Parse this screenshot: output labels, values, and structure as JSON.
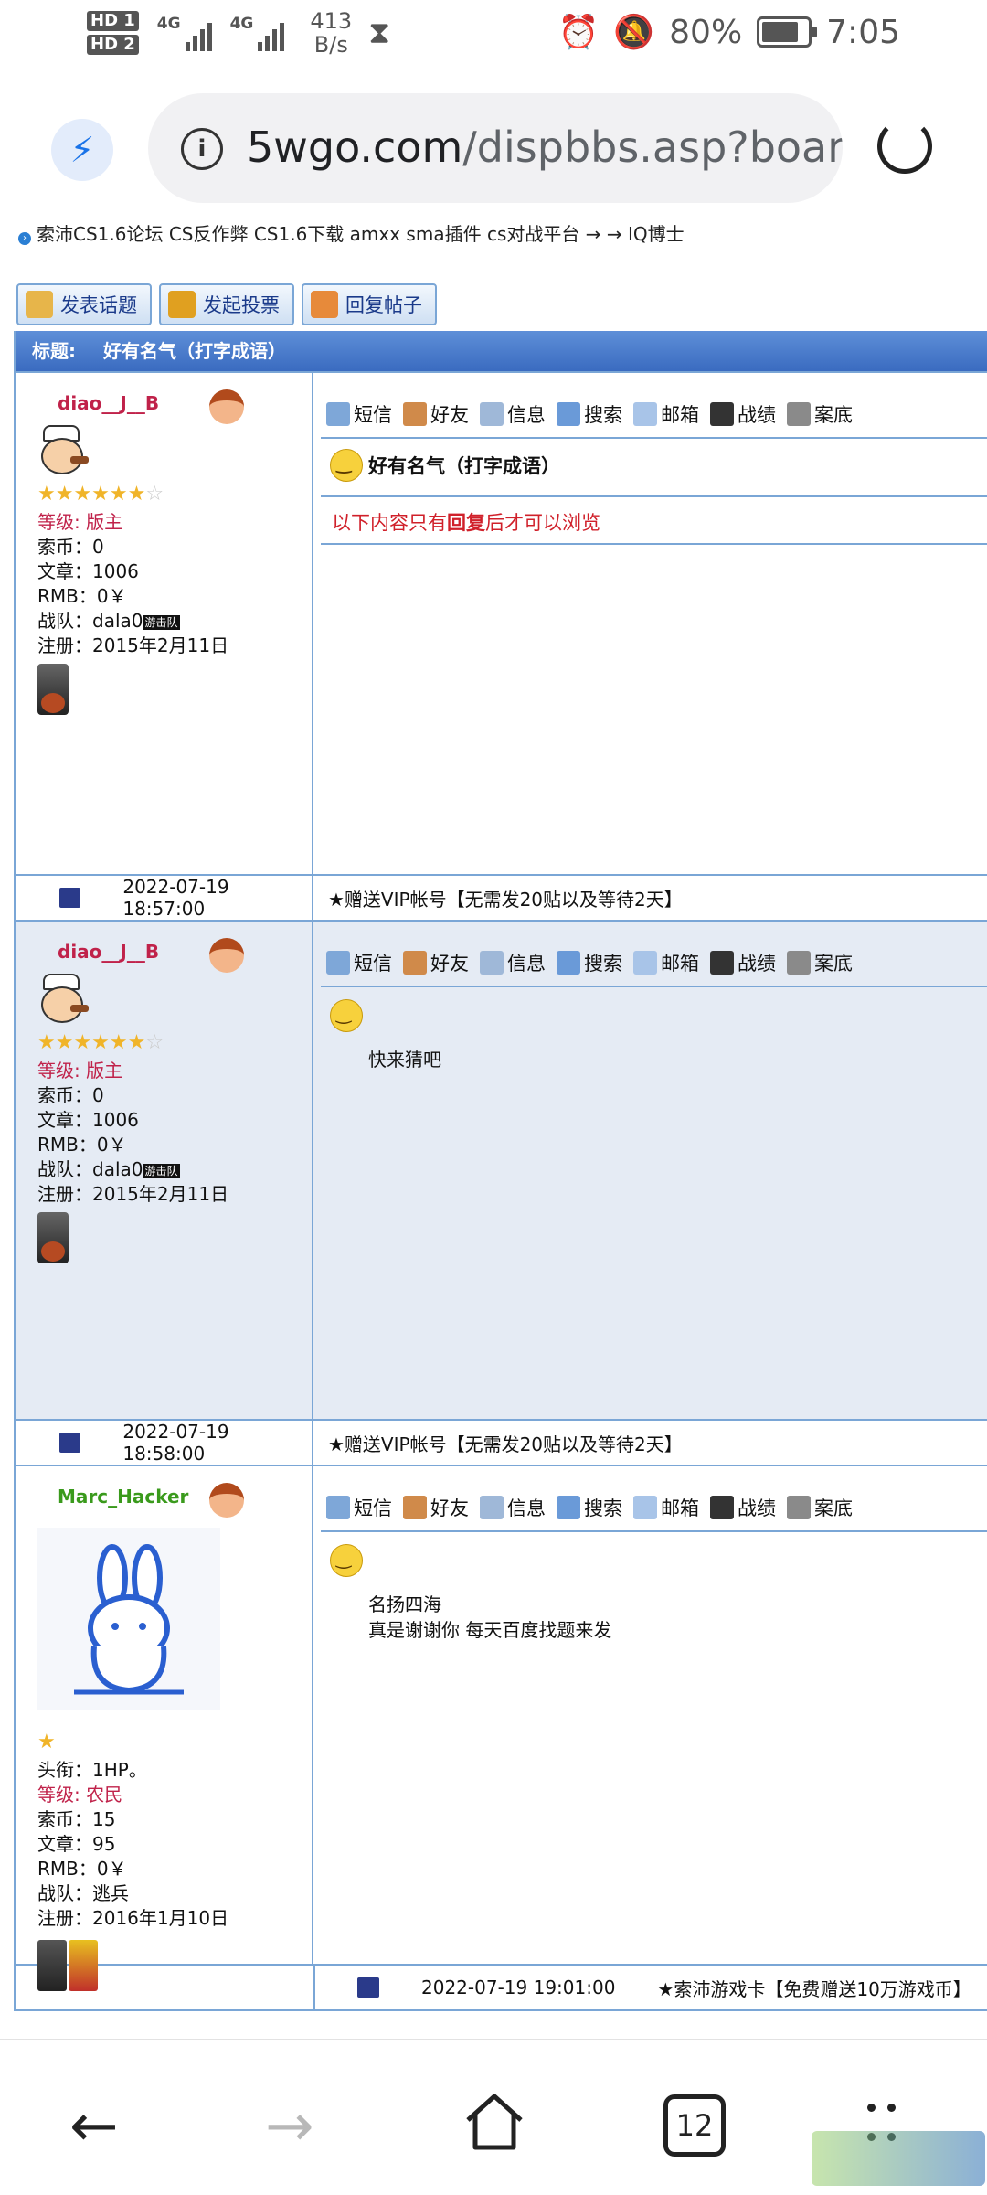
{
  "status_bar": {
    "hd1": "HD 1",
    "hd2": "HD 2",
    "net1": "4G",
    "net2": "4G",
    "speed_value": "413",
    "speed_unit": "B/s",
    "battery": "80%",
    "battery_level": 0.8,
    "time": "7:05"
  },
  "address_bar": {
    "domain": "5wgo.com",
    "path": "/dispbbs.asp?boarc"
  },
  "breadcrumb": "索沛CS1.6论坛 CS反作弊 CS1.6下载 amxx sma插件 cs对战平台 → → IQ博士",
  "toolbar": {
    "new_topic": "发表话题",
    "new_poll": "发起投票",
    "reply": "回复帖子"
  },
  "thread": {
    "title_label": "标题:",
    "title": "好有名气（打字成语）"
  },
  "post_tools": [
    "短信",
    "好友",
    "信息",
    "搜索",
    "邮箱",
    "战绩",
    "案底"
  ],
  "posts": [
    {
      "username": "diao__J__B",
      "stars_on": 6,
      "level_label": "等级:",
      "level": "版主",
      "coins": "索币：0",
      "articles": "文章：1006",
      "rmb": "RMB：0￥",
      "team": "战队：dala0",
      "team_badge": "游击队",
      "registered": "注册：2015年2月11日",
      "title": "好有名气（打字成语）",
      "locked_pre": "以下内容只有",
      "locked_bold": "回复",
      "locked_post": "后才可以浏览",
      "datetime": "2022-07-19 18:57:00",
      "signature": "★赠送VIP帐号【无需发20贴以及等待2天】"
    },
    {
      "username": "diao__J__B",
      "stars_on": 6,
      "level_label": "等级:",
      "level": "版主",
      "coins": "索币：0",
      "articles": "文章：1006",
      "rmb": "RMB：0￥",
      "team": "战队：dala0",
      "team_badge": "游击队",
      "registered": "注册：2015年2月11日",
      "content": "快来猜吧",
      "datetime": "2022-07-19 18:58:00",
      "signature": "★赠送VIP帐号【无需发20贴以及等待2天】"
    },
    {
      "username": "Marc_Hacker",
      "stars_on": 1,
      "title_field": "头衔：1HP。",
      "level_label": "等级:",
      "level": "农民",
      "coins": "索币：15",
      "articles": "文章：95",
      "rmb": "RMB：0￥",
      "team": "战队：逃兵",
      "registered": "注册：2016年1月10日",
      "content_line1": "名扬四海",
      "content_line2": "真是谢谢你 每天百度找题来发",
      "datetime": "2022-07-19 19:01:00",
      "signature": "★索沛游戏卡【免费赠送10万游戏币】"
    }
  ],
  "nav": {
    "tab_count": "12"
  },
  "colors": {
    "accent": "#1a73e8",
    "forum_border": "#7aa6d6",
    "title_bar": "#3a6bc0",
    "moderator_red": "#c0224a",
    "member_green": "#3a9a1c"
  }
}
